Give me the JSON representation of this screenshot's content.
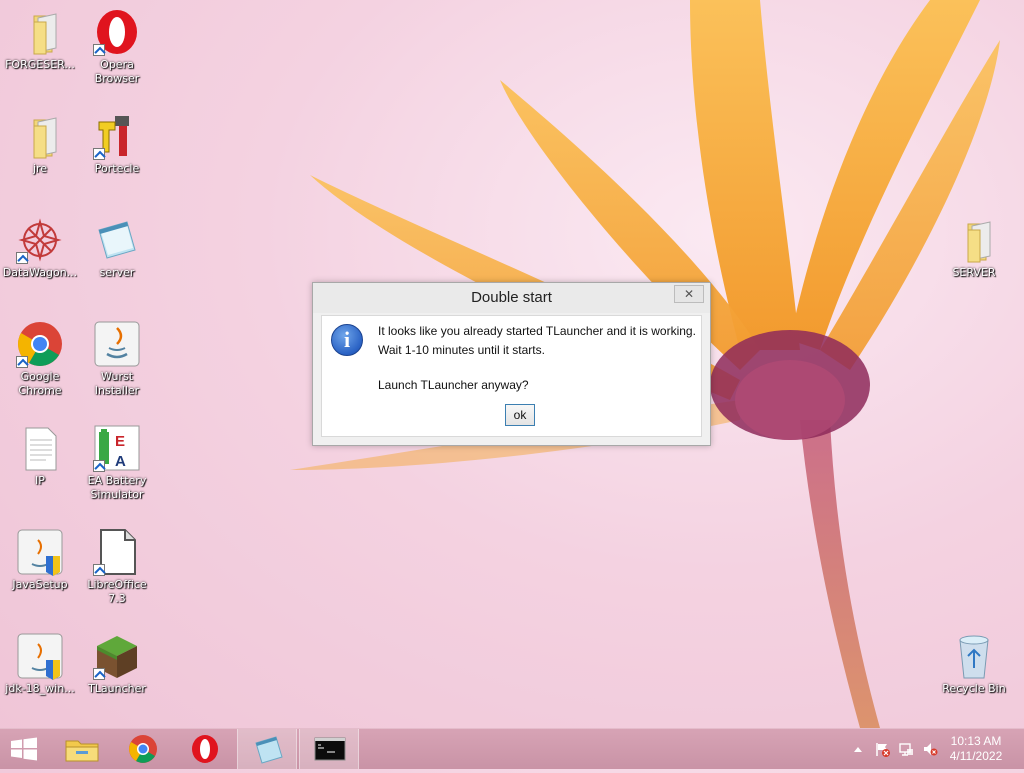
{
  "desktop": {
    "icons": [
      {
        "label": "FORGESER...",
        "icon": "folder-icon"
      },
      {
        "label": "Opera Browser",
        "icon": "opera-icon"
      },
      {
        "label": "jre",
        "icon": "folder-icon"
      },
      {
        "label": "Portecle",
        "icon": "portecle-icon"
      },
      {
        "label": "DataWagon...",
        "icon": "datawagon-icon"
      },
      {
        "label": "server",
        "icon": "notepad-icon"
      },
      {
        "label": "Google Chrome",
        "icon": "chrome-icon"
      },
      {
        "label": "Wurst Installer",
        "icon": "java-icon"
      },
      {
        "label": "IP",
        "icon": "text-file-icon"
      },
      {
        "label": "EA Battery Simulator",
        "icon": "ea-battery-icon"
      },
      {
        "label": "JavaSetup",
        "icon": "java-setup-icon"
      },
      {
        "label": "LibreOffice 7.3",
        "icon": "libreoffice-icon"
      },
      {
        "label": "jdk-18_win...",
        "icon": "java-setup-icon"
      },
      {
        "label": "TLauncher",
        "icon": "minecraft-icon"
      },
      {
        "label": "SERVER",
        "icon": "folder-icon"
      },
      {
        "label": "Recycle Bin",
        "icon": "recycle-bin-icon"
      }
    ]
  },
  "dialog": {
    "title": "Double start",
    "close_label": "✕",
    "message_line1": "It looks like you already started TLauncher and it is working.",
    "message_line2": "Wait 1-10 minutes until it starts.",
    "question": "Launch TLauncher anyway?",
    "ok_label": "ok",
    "icon": "info-icon"
  },
  "taskbar": {
    "items": [
      "windows-start-icon",
      "file-explorer-icon",
      "chrome-icon",
      "opera-icon",
      "notepad-icon",
      "cmd-icon"
    ],
    "tray": [
      "show-hidden-icons",
      "action-center-flag-icon",
      "network-icon",
      "volume-muted-icon"
    ],
    "time": "10:13 AM",
    "date": "4/11/2022"
  },
  "colors": {
    "accent": "#3c7fb1",
    "taskbar": "#c993a6",
    "petal": "#f6a63a"
  }
}
